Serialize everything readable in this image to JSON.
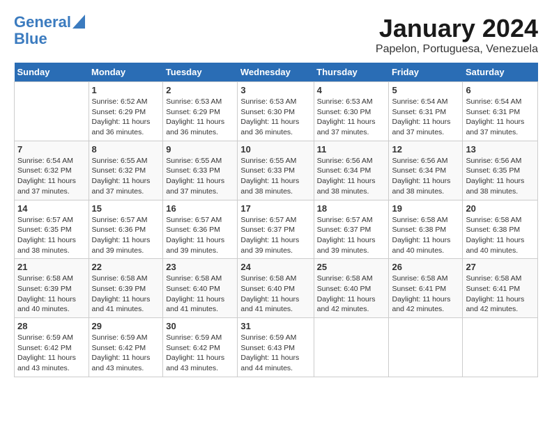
{
  "logo": {
    "line1": "General",
    "line2": "Blue"
  },
  "title": "January 2024",
  "subtitle": "Papelon, Portuguesa, Venezuela",
  "days_of_week": [
    "Sunday",
    "Monday",
    "Tuesday",
    "Wednesday",
    "Thursday",
    "Friday",
    "Saturday"
  ],
  "weeks": [
    [
      {
        "num": "",
        "sunrise": "",
        "sunset": "",
        "daylight": ""
      },
      {
        "num": "1",
        "sunrise": "Sunrise: 6:52 AM",
        "sunset": "Sunset: 6:29 PM",
        "daylight": "Daylight: 11 hours and 36 minutes."
      },
      {
        "num": "2",
        "sunrise": "Sunrise: 6:53 AM",
        "sunset": "Sunset: 6:29 PM",
        "daylight": "Daylight: 11 hours and 36 minutes."
      },
      {
        "num": "3",
        "sunrise": "Sunrise: 6:53 AM",
        "sunset": "Sunset: 6:30 PM",
        "daylight": "Daylight: 11 hours and 36 minutes."
      },
      {
        "num": "4",
        "sunrise": "Sunrise: 6:53 AM",
        "sunset": "Sunset: 6:30 PM",
        "daylight": "Daylight: 11 hours and 37 minutes."
      },
      {
        "num": "5",
        "sunrise": "Sunrise: 6:54 AM",
        "sunset": "Sunset: 6:31 PM",
        "daylight": "Daylight: 11 hours and 37 minutes."
      },
      {
        "num": "6",
        "sunrise": "Sunrise: 6:54 AM",
        "sunset": "Sunset: 6:31 PM",
        "daylight": "Daylight: 11 hours and 37 minutes."
      }
    ],
    [
      {
        "num": "7",
        "sunrise": "Sunrise: 6:54 AM",
        "sunset": "Sunset: 6:32 PM",
        "daylight": "Daylight: 11 hours and 37 minutes."
      },
      {
        "num": "8",
        "sunrise": "Sunrise: 6:55 AM",
        "sunset": "Sunset: 6:32 PM",
        "daylight": "Daylight: 11 hours and 37 minutes."
      },
      {
        "num": "9",
        "sunrise": "Sunrise: 6:55 AM",
        "sunset": "Sunset: 6:33 PM",
        "daylight": "Daylight: 11 hours and 37 minutes."
      },
      {
        "num": "10",
        "sunrise": "Sunrise: 6:55 AM",
        "sunset": "Sunset: 6:33 PM",
        "daylight": "Daylight: 11 hours and 38 minutes."
      },
      {
        "num": "11",
        "sunrise": "Sunrise: 6:56 AM",
        "sunset": "Sunset: 6:34 PM",
        "daylight": "Daylight: 11 hours and 38 minutes."
      },
      {
        "num": "12",
        "sunrise": "Sunrise: 6:56 AM",
        "sunset": "Sunset: 6:34 PM",
        "daylight": "Daylight: 11 hours and 38 minutes."
      },
      {
        "num": "13",
        "sunrise": "Sunrise: 6:56 AM",
        "sunset": "Sunset: 6:35 PM",
        "daylight": "Daylight: 11 hours and 38 minutes."
      }
    ],
    [
      {
        "num": "14",
        "sunrise": "Sunrise: 6:57 AM",
        "sunset": "Sunset: 6:35 PM",
        "daylight": "Daylight: 11 hours and 38 minutes."
      },
      {
        "num": "15",
        "sunrise": "Sunrise: 6:57 AM",
        "sunset": "Sunset: 6:36 PM",
        "daylight": "Daylight: 11 hours and 39 minutes."
      },
      {
        "num": "16",
        "sunrise": "Sunrise: 6:57 AM",
        "sunset": "Sunset: 6:36 PM",
        "daylight": "Daylight: 11 hours and 39 minutes."
      },
      {
        "num": "17",
        "sunrise": "Sunrise: 6:57 AM",
        "sunset": "Sunset: 6:37 PM",
        "daylight": "Daylight: 11 hours and 39 minutes."
      },
      {
        "num": "18",
        "sunrise": "Sunrise: 6:57 AM",
        "sunset": "Sunset: 6:37 PM",
        "daylight": "Daylight: 11 hours and 39 minutes."
      },
      {
        "num": "19",
        "sunrise": "Sunrise: 6:58 AM",
        "sunset": "Sunset: 6:38 PM",
        "daylight": "Daylight: 11 hours and 40 minutes."
      },
      {
        "num": "20",
        "sunrise": "Sunrise: 6:58 AM",
        "sunset": "Sunset: 6:38 PM",
        "daylight": "Daylight: 11 hours and 40 minutes."
      }
    ],
    [
      {
        "num": "21",
        "sunrise": "Sunrise: 6:58 AM",
        "sunset": "Sunset: 6:39 PM",
        "daylight": "Daylight: 11 hours and 40 minutes."
      },
      {
        "num": "22",
        "sunrise": "Sunrise: 6:58 AM",
        "sunset": "Sunset: 6:39 PM",
        "daylight": "Daylight: 11 hours and 41 minutes."
      },
      {
        "num": "23",
        "sunrise": "Sunrise: 6:58 AM",
        "sunset": "Sunset: 6:40 PM",
        "daylight": "Daylight: 11 hours and 41 minutes."
      },
      {
        "num": "24",
        "sunrise": "Sunrise: 6:58 AM",
        "sunset": "Sunset: 6:40 PM",
        "daylight": "Daylight: 11 hours and 41 minutes."
      },
      {
        "num": "25",
        "sunrise": "Sunrise: 6:58 AM",
        "sunset": "Sunset: 6:40 PM",
        "daylight": "Daylight: 11 hours and 42 minutes."
      },
      {
        "num": "26",
        "sunrise": "Sunrise: 6:58 AM",
        "sunset": "Sunset: 6:41 PM",
        "daylight": "Daylight: 11 hours and 42 minutes."
      },
      {
        "num": "27",
        "sunrise": "Sunrise: 6:58 AM",
        "sunset": "Sunset: 6:41 PM",
        "daylight": "Daylight: 11 hours and 42 minutes."
      }
    ],
    [
      {
        "num": "28",
        "sunrise": "Sunrise: 6:59 AM",
        "sunset": "Sunset: 6:42 PM",
        "daylight": "Daylight: 11 hours and 43 minutes."
      },
      {
        "num": "29",
        "sunrise": "Sunrise: 6:59 AM",
        "sunset": "Sunset: 6:42 PM",
        "daylight": "Daylight: 11 hours and 43 minutes."
      },
      {
        "num": "30",
        "sunrise": "Sunrise: 6:59 AM",
        "sunset": "Sunset: 6:42 PM",
        "daylight": "Daylight: 11 hours and 43 minutes."
      },
      {
        "num": "31",
        "sunrise": "Sunrise: 6:59 AM",
        "sunset": "Sunset: 6:43 PM",
        "daylight": "Daylight: 11 hours and 44 minutes."
      },
      {
        "num": "",
        "sunrise": "",
        "sunset": "",
        "daylight": ""
      },
      {
        "num": "",
        "sunrise": "",
        "sunset": "",
        "daylight": ""
      },
      {
        "num": "",
        "sunrise": "",
        "sunset": "",
        "daylight": ""
      }
    ]
  ]
}
